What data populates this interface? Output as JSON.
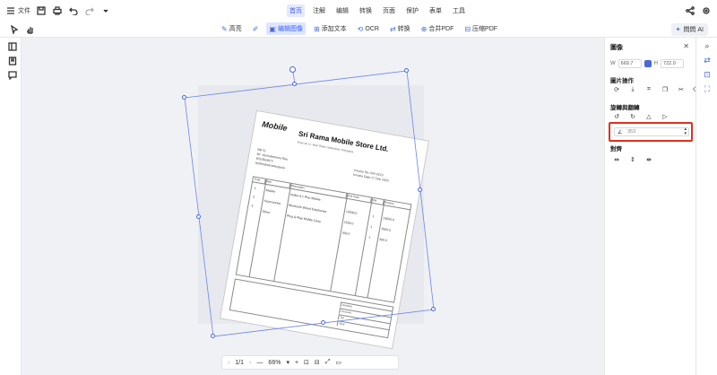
{
  "menubar": {
    "file_label": "文件",
    "menus": [
      "首页",
      "注解",
      "编辑",
      "转换",
      "页面",
      "保护",
      "表单",
      "工具"
    ],
    "active_menu_index": 0
  },
  "toolbar": {
    "tools": [
      {
        "label": "高亮",
        "icon": "highlight-icon"
      },
      {
        "label": "",
        "icon": "pen-icon"
      },
      {
        "label": "编辑图像",
        "icon": "edit-image-icon",
        "active": true
      },
      {
        "label": "添加文本",
        "icon": "add-text-icon"
      },
      {
        "label": "OCR",
        "icon": "ocr-icon"
      },
      {
        "label": "转换",
        "icon": "convert-icon"
      },
      {
        "label": "合并PDF",
        "icon": "merge-icon"
      },
      {
        "label": "压缩PDF",
        "icon": "compress-icon"
      }
    ],
    "ai_label": "問問 AI"
  },
  "document": {
    "logo": "Mobile",
    "store_name": "Sri Rama Mobile Store Ltd.",
    "address": "Shop No 12, Main Road, Hyderabad, Telangana",
    "bill_to": [
      "Bill To",
      "Mr. Venkateswara Rao",
      "9010564872",
      "Hyderabad,telangana"
    ],
    "invoice_no_label": "Invoice No.",
    "invoice_no": "INV-0210",
    "invoice_date_label": "Invoice Date",
    "invoice_date": "27 Feb 2020",
    "table_headers": [
      "S.No",
      "Item",
      "Description",
      "Unit Price",
      "Qty",
      "Amount"
    ],
    "rows": [
      {
        "sno": "1",
        "item": "Mobile",
        "desc": "Nokia 6.1 Plus Mobile",
        "price": "13000.0",
        "qty": "1",
        "amt": "13000.0"
      },
      {
        "sno": "2",
        "item": "Accessories",
        "desc": "Bluetooth Wired Earphones",
        "price": "1500.0",
        "qty": "1",
        "amt": "1500.0"
      },
      {
        "sno": "3",
        "item": "Other",
        "desc": "Plug & Play Mobile Case",
        "price": "300.0",
        "qty": "1",
        "amt": "300.0"
      }
    ],
    "totals": [
      "Subtotal",
      "Discount",
      "Tax",
      "Total"
    ]
  },
  "page_controls": {
    "page": "1/1",
    "zoom": "66%"
  },
  "right_panel": {
    "title": "圖像",
    "w_label": "W",
    "w_value": "669.7",
    "h_label": "H",
    "h_value": "722.0",
    "section_image_ops": "圖片操作",
    "section_rotate": "旋轉與翻轉",
    "angle_value": "353",
    "section_align": "對齊"
  }
}
